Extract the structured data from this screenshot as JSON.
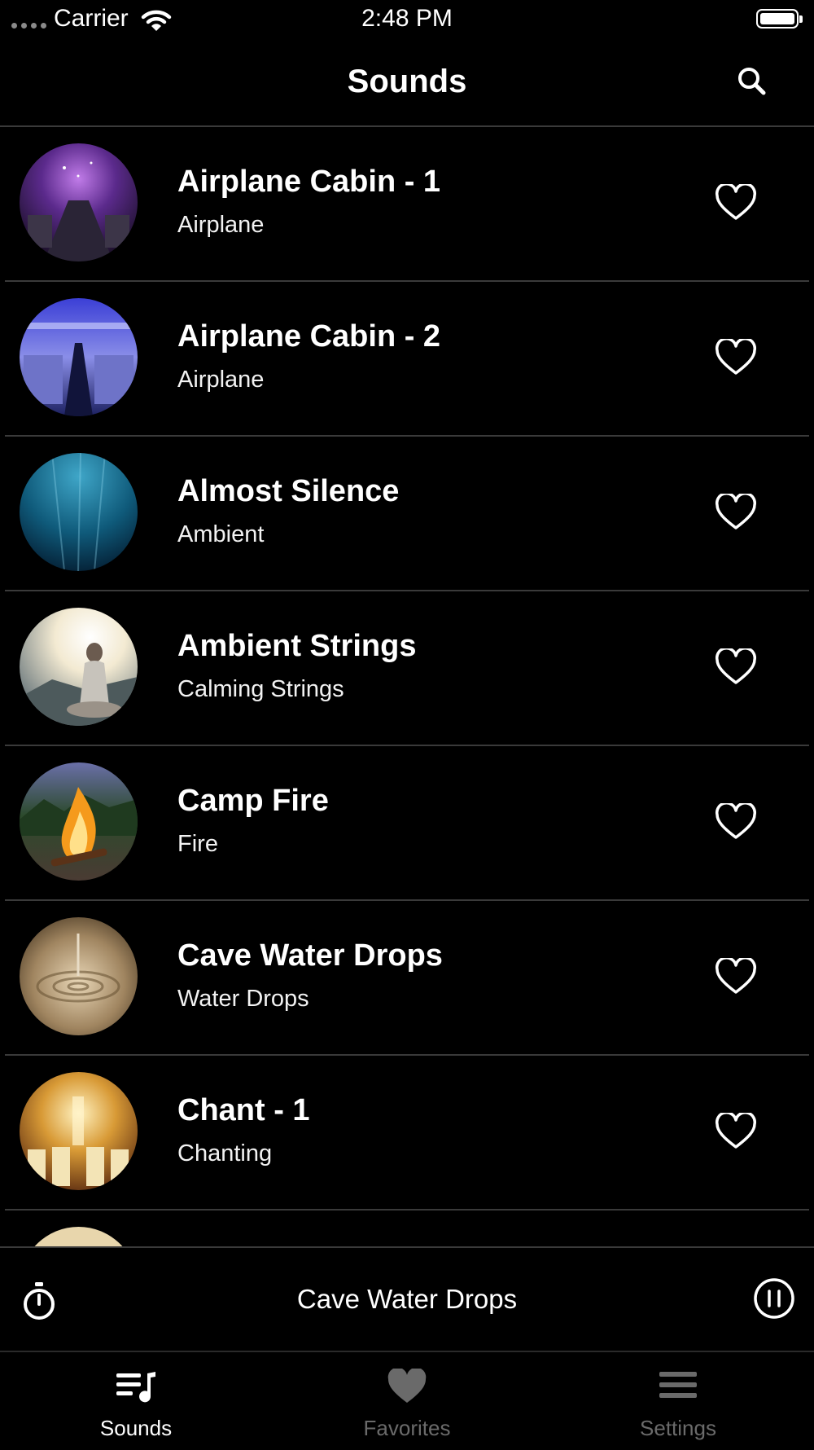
{
  "status_bar": {
    "carrier": "Carrier",
    "time": "2:48 PM"
  },
  "nav": {
    "title": "Sounds",
    "search_icon": "search-icon"
  },
  "sounds": [
    {
      "title": "Airplane Cabin - 1",
      "category": "Airplane",
      "thumb_icon": "airplane-cabin-purple-thumbnail",
      "favorite": false
    },
    {
      "title": "Airplane Cabin - 2",
      "category": "Airplane",
      "thumb_icon": "airplane-cabin-blue-thumbnail",
      "favorite": false
    },
    {
      "title": "Almost Silence",
      "category": "Ambient",
      "thumb_icon": "underwater-thumbnail",
      "favorite": false
    },
    {
      "title": "Ambient Strings",
      "category": "Calming Strings",
      "thumb_icon": "meditation-thumbnail",
      "favorite": false
    },
    {
      "title": "Camp Fire",
      "category": "Fire",
      "thumb_icon": "campfire-thumbnail",
      "favorite": false
    },
    {
      "title": "Cave Water Drops",
      "category": "Water Drops",
      "thumb_icon": "water-drop-thumbnail",
      "favorite": false
    },
    {
      "title": "Chant - 1",
      "category": "Chanting",
      "thumb_icon": "choir-thumbnail",
      "favorite": false
    }
  ],
  "player": {
    "now_playing": "Cave Water Drops",
    "timer_icon": "stopwatch-icon",
    "control_icon": "pause-icon"
  },
  "tabs": [
    {
      "label": "Sounds",
      "icon": "music-list-icon",
      "active": true
    },
    {
      "label": "Favorites",
      "icon": "heart-icon",
      "active": false
    },
    {
      "label": "Settings",
      "icon": "menu-lines-icon",
      "active": false
    }
  ],
  "colors": {
    "background": "#000000",
    "separator": "#3a3a3a",
    "active_tab": "#ffffff",
    "inactive_tab": "#6a6a6a"
  }
}
